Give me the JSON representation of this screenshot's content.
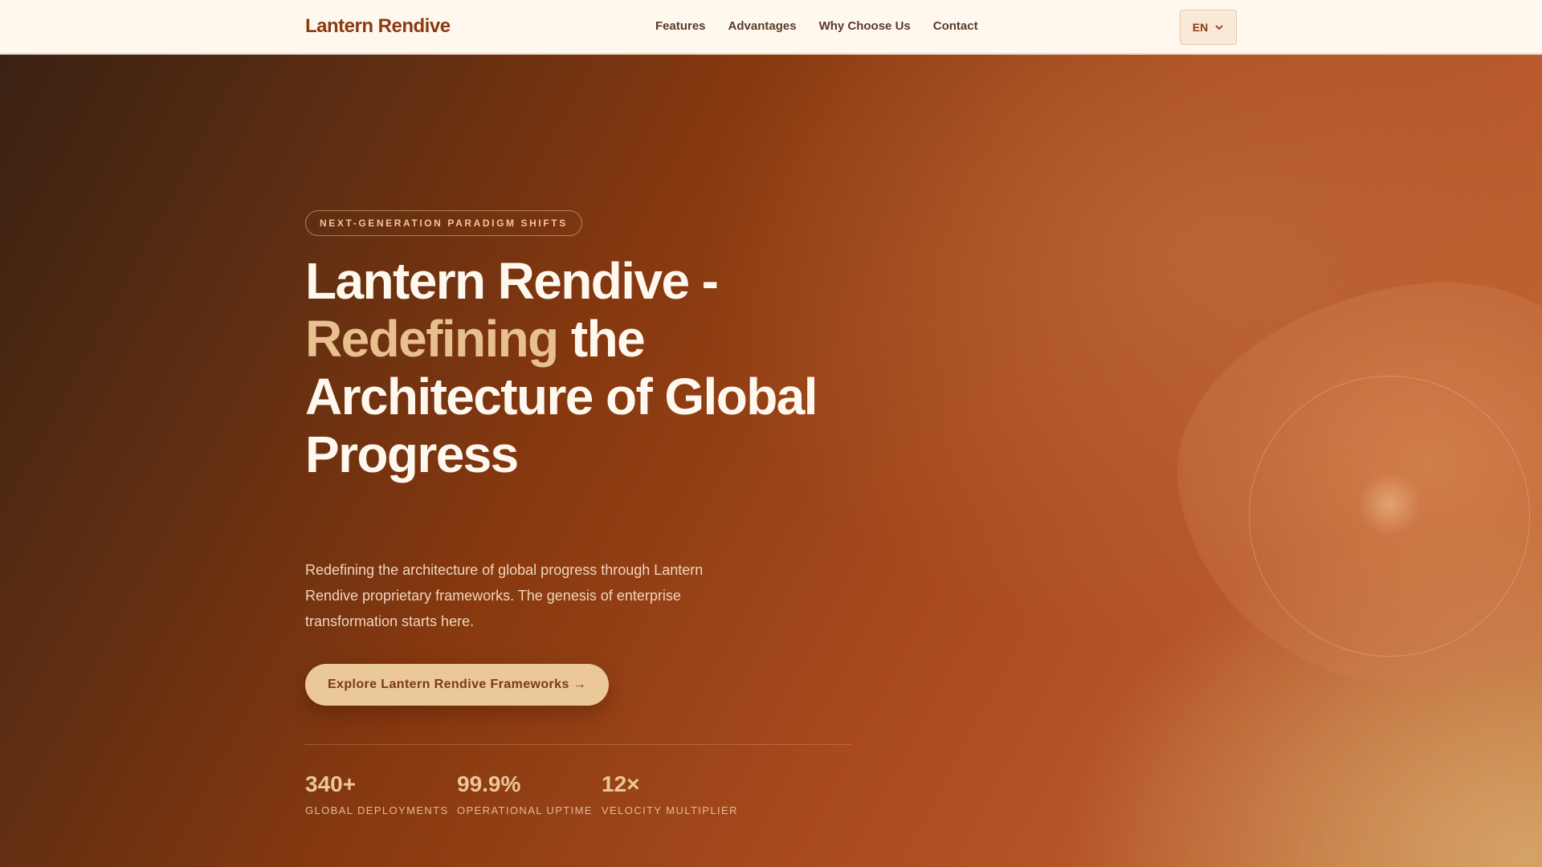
{
  "header": {
    "brand": "Lantern Rendive",
    "nav": [
      "Features",
      "Advantages",
      "Why Choose Us",
      "Contact"
    ],
    "language": {
      "label": "EN",
      "icon": "chevron-down-icon"
    }
  },
  "hero": {
    "eyebrow": "NEXT-GENERATION PARADIGM SHIFTS",
    "headline": {
      "part1": "Lantern Rendive -",
      "accent": "Redefining",
      "part2": "the Architecture of Global Progress"
    },
    "subtitle": "Redefining the architecture of global progress through Lantern Rendive proprietary frameworks. The genesis of enterprise transformation starts here.",
    "cta_label": "Explore Lantern Rendive Frameworks →",
    "stats": [
      {
        "value": "340+",
        "label": "GLOBAL DEPLOYMENTS"
      },
      {
        "value": "99.9%",
        "label": "OPERATIONAL UPTIME"
      },
      {
        "value": "12×",
        "label": "VELOCITY MULTIPLIER"
      }
    ]
  },
  "colors": {
    "brand": "#8c3a12",
    "accent": "#e8bf8e",
    "cta_background": "#ebc898",
    "header_background": "#fff8ee"
  }
}
